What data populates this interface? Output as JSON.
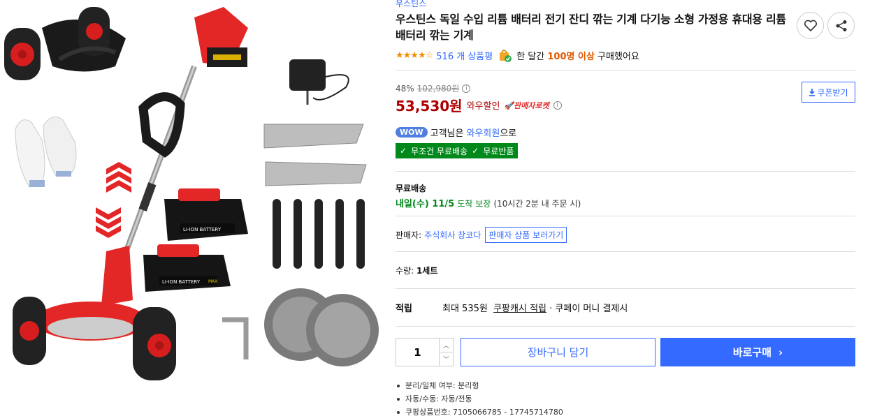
{
  "product": {
    "brand": "우스틴스",
    "title": "우스틴스 독일 수입 리튬 배터리 전기 잔디 깎는 기계 다기능 소형 가정용 휴대용 리튬 배터리 깎는 기계",
    "rating_stars": 4.5,
    "review_count": "516 개 상품평",
    "buyers_prefix": "한 달간",
    "buyers_highlight": "100명 이상",
    "buyers_suffix": "구매했어요"
  },
  "image_labels": {
    "battery_text": "LI-ION BATTERY",
    "battery_badge": "MAX"
  },
  "price": {
    "discount_rate": "48%",
    "original_price": "102,980원",
    "sale_price": "53,530원",
    "wow_discount": "와우할인",
    "rocket_badge": "판매자로켓",
    "coupon_label": "쿠폰받기"
  },
  "membership": {
    "wow_badge": "WOW",
    "prefix": "고객님은",
    "member_text": "와우회원",
    "suffix": "으로",
    "free_shipping": "무조건 무료배송",
    "free_return": "무료반품"
  },
  "shipping": {
    "label": "무료배송",
    "date": "내일(수) 11/5",
    "guarantee": "도착 보장",
    "note": "(10시간 2분 내 주문 시)"
  },
  "seller": {
    "label": "판매자:",
    "name": "주식회사 창코다",
    "link_label": "판매자 상품 보러가기"
  },
  "quantity": {
    "label": "수량:",
    "value": "1세트",
    "input_value": "1"
  },
  "points": {
    "label": "적립",
    "max_text": "최대 535원",
    "cash_link": "쿠팡캐시 적립",
    "tail_text": "· 쿠페이 머니 결제시"
  },
  "actions": {
    "cart": "장바구니 담기",
    "buy": "바로구매"
  },
  "specs": [
    "분리/일체 여부: 분리형",
    "자동/수동: 자동/전동",
    "쿠팡상품번호: 7105066785 - 17745714780"
  ],
  "colors": {
    "accent_blue": "#346aff",
    "price_red": "#ae0000",
    "wow_green": "#00891a",
    "product_red": "#e32626"
  }
}
